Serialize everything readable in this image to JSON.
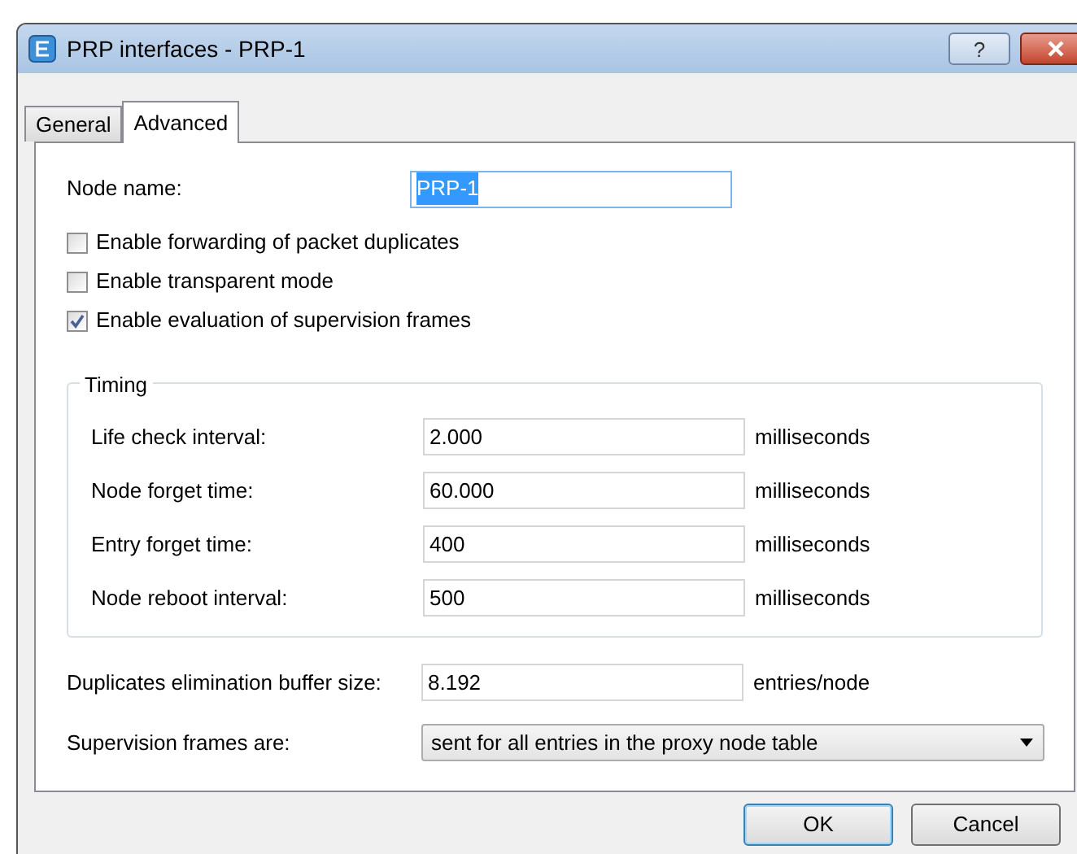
{
  "window": {
    "title": "PRP interfaces - PRP-1",
    "help_button": "?"
  },
  "tabs": [
    {
      "label": "General",
      "selected": false
    },
    {
      "label": "Advanced",
      "selected": true
    }
  ],
  "node_name": {
    "label": "Node name:",
    "value": "PRP-1",
    "value_selected": true
  },
  "checkboxes": [
    {
      "label": "Enable forwarding of packet duplicates",
      "checked": false
    },
    {
      "label": "Enable transparent mode",
      "checked": false
    },
    {
      "label": "Enable evaluation of supervision frames",
      "checked": true
    }
  ],
  "timing": {
    "title": "Timing",
    "rows": [
      {
        "label": "Life check interval:",
        "value": "2.000",
        "unit": "milliseconds"
      },
      {
        "label": "Node forget time:",
        "value": "60.000",
        "unit": "milliseconds"
      },
      {
        "label": "Entry forget time:",
        "value": "400",
        "unit": "milliseconds"
      },
      {
        "label": "Node reboot interval:",
        "value": "500",
        "unit": "milliseconds"
      }
    ]
  },
  "buffer_size": {
    "label": "Duplicates elimination buffer size:",
    "value": "8.192",
    "unit": "entries/node"
  },
  "supervision": {
    "label": "Supervision frames are:",
    "value": "sent for all entries in the proxy node table"
  },
  "buttons": [
    {
      "label": "OK",
      "default": true
    },
    {
      "label": "Cancel",
      "default": false
    }
  ]
}
